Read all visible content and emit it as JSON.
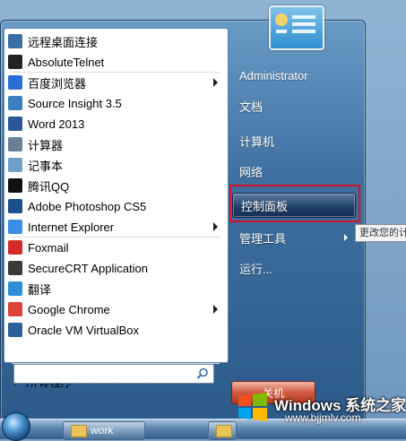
{
  "programs": [
    {
      "label": "远程桌面连接",
      "icon": "remote-desktop-icon",
      "color": "#3a6ea5",
      "has_arrow": false
    },
    {
      "label": "AbsoluteTelnet",
      "icon": "telnet-icon",
      "color": "#222222",
      "has_arrow": false
    },
    {
      "label": "百度浏览器",
      "icon": "baidu-browser-icon",
      "color": "#2a6fd6",
      "has_arrow": true
    },
    {
      "label": "Source Insight 3.5",
      "icon": "source-insight-icon",
      "color": "#3c7fc1",
      "has_arrow": false
    },
    {
      "label": "Word 2013",
      "icon": "word-icon",
      "color": "#2b579a",
      "has_arrow": false
    },
    {
      "label": "计算器",
      "icon": "calculator-icon",
      "color": "#6a7f95",
      "has_arrow": false
    },
    {
      "label": "记事本",
      "icon": "notepad-icon",
      "color": "#6fa0c9",
      "has_arrow": false
    },
    {
      "label": "腾讯QQ",
      "icon": "qq-penguin-icon",
      "color": "#111111",
      "has_arrow": false
    },
    {
      "label": "Adobe Photoshop CS5",
      "icon": "photoshop-icon",
      "color": "#1c4f8c",
      "has_arrow": false
    },
    {
      "label": "Internet Explorer",
      "icon": "internet-explorer-icon",
      "color": "#3a8ee6",
      "has_arrow": true
    },
    {
      "label": "Foxmail",
      "icon": "foxmail-icon",
      "color": "#d62b2b",
      "has_arrow": false
    },
    {
      "label": "SecureCRT Application",
      "icon": "securecrt-icon",
      "color": "#3b3b3b",
      "has_arrow": false
    },
    {
      "label": "翻译",
      "icon": "translate-icon",
      "color": "#2a8fd6",
      "has_arrow": false
    },
    {
      "label": "Google Chrome",
      "icon": "chrome-icon",
      "color": "#db4437",
      "has_arrow": true
    },
    {
      "label": "Oracle VM VirtualBox",
      "icon": "virtualbox-icon",
      "color": "#2d5f9a",
      "has_arrow": false
    }
  ],
  "all_programs_label": "所有程序",
  "search": {
    "value": "",
    "placeholder": ""
  },
  "right_items": [
    {
      "label": "Administrator",
      "has_arrow": false,
      "highlighted": false
    },
    {
      "label": "文档",
      "has_arrow": false,
      "highlighted": false
    },
    {
      "label": "计算机",
      "has_arrow": false,
      "highlighted": false
    },
    {
      "label": "网络",
      "has_arrow": false,
      "highlighted": false
    },
    {
      "label": "控制面板",
      "has_arrow": false,
      "highlighted": true
    },
    {
      "label": "管理工具",
      "has_arrow": true,
      "highlighted": false
    },
    {
      "label": "运行...",
      "has_arrow": false,
      "highlighted": false
    }
  ],
  "tooltip": "更改您的计",
  "shutdown_label": "关机",
  "taskbar": {
    "window_label": "work"
  },
  "watermark": {
    "brand": "Windows 系统之家",
    "url": "www.bjjmlv.com"
  },
  "colors": {
    "highlight_outline": "#d6142b",
    "accent": "#2c5b8a"
  }
}
